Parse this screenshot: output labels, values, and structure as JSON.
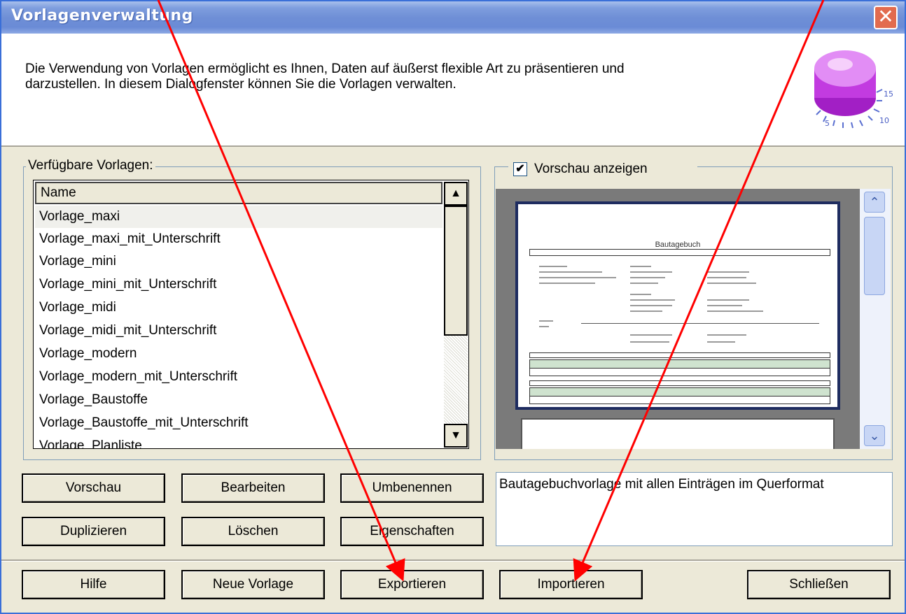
{
  "window": {
    "title": "Vorlagenverwaltung",
    "close_glyph": "✕"
  },
  "header": {
    "intro_line1": "Die Verwendung von Vorlagen ermöglicht es Ihnen, Daten auf äußerst flexible Art zu präsentieren und",
    "intro_line2": "darzustellen. In diesem Dialogfenster können Sie die Vorlagen verwalten.",
    "knob_icon": "timer-knob-icon",
    "knob_labels": [
      "5",
      "10",
      "15"
    ]
  },
  "templates": {
    "legend": "Verfügbare Vorlagen:",
    "column_header": "Name",
    "selected_index": 0,
    "items": [
      "Vorlage_maxi",
      "Vorlage_maxi_mit_Unterschrift",
      "Vorlage_mini",
      "Vorlage_mini_mit_Unterschrift",
      "Vorlage_midi",
      "Vorlage_midi_mit_Unterschrift",
      "Vorlage_modern",
      "Vorlage_modern_mit_Unterschrift",
      "Vorlage_Baustoffe",
      "Vorlage_Baustoffe_mit_Unterschrift",
      "Vorlage_Planliste"
    ]
  },
  "preview": {
    "checkbox_label": "Vorschau anzeigen",
    "checked": true,
    "check_glyph": "✔",
    "document_title": "Bautagebuch",
    "description": "Bautagebuchvorlage mit allen Einträgen im Querformat"
  },
  "actions": {
    "vorschau": "Vorschau",
    "bearbeiten": "Bearbeiten",
    "umbenennen": "Umbenennen",
    "duplizieren": "Duplizieren",
    "loeschen": "Löschen",
    "eigenschaften": "Eigenschaften"
  },
  "footer": {
    "hilfe": "Hilfe",
    "neue_vorlage": "Neue Vorlage",
    "exportieren": "Exportieren",
    "importieren": "Importieren",
    "schliessen": "Schließen"
  },
  "colors": {
    "title_bar": "#7f9ede",
    "close_button": "#e26b4e",
    "dialog_face": "#ece9d8",
    "annotation_arrow": "#ff0000"
  }
}
